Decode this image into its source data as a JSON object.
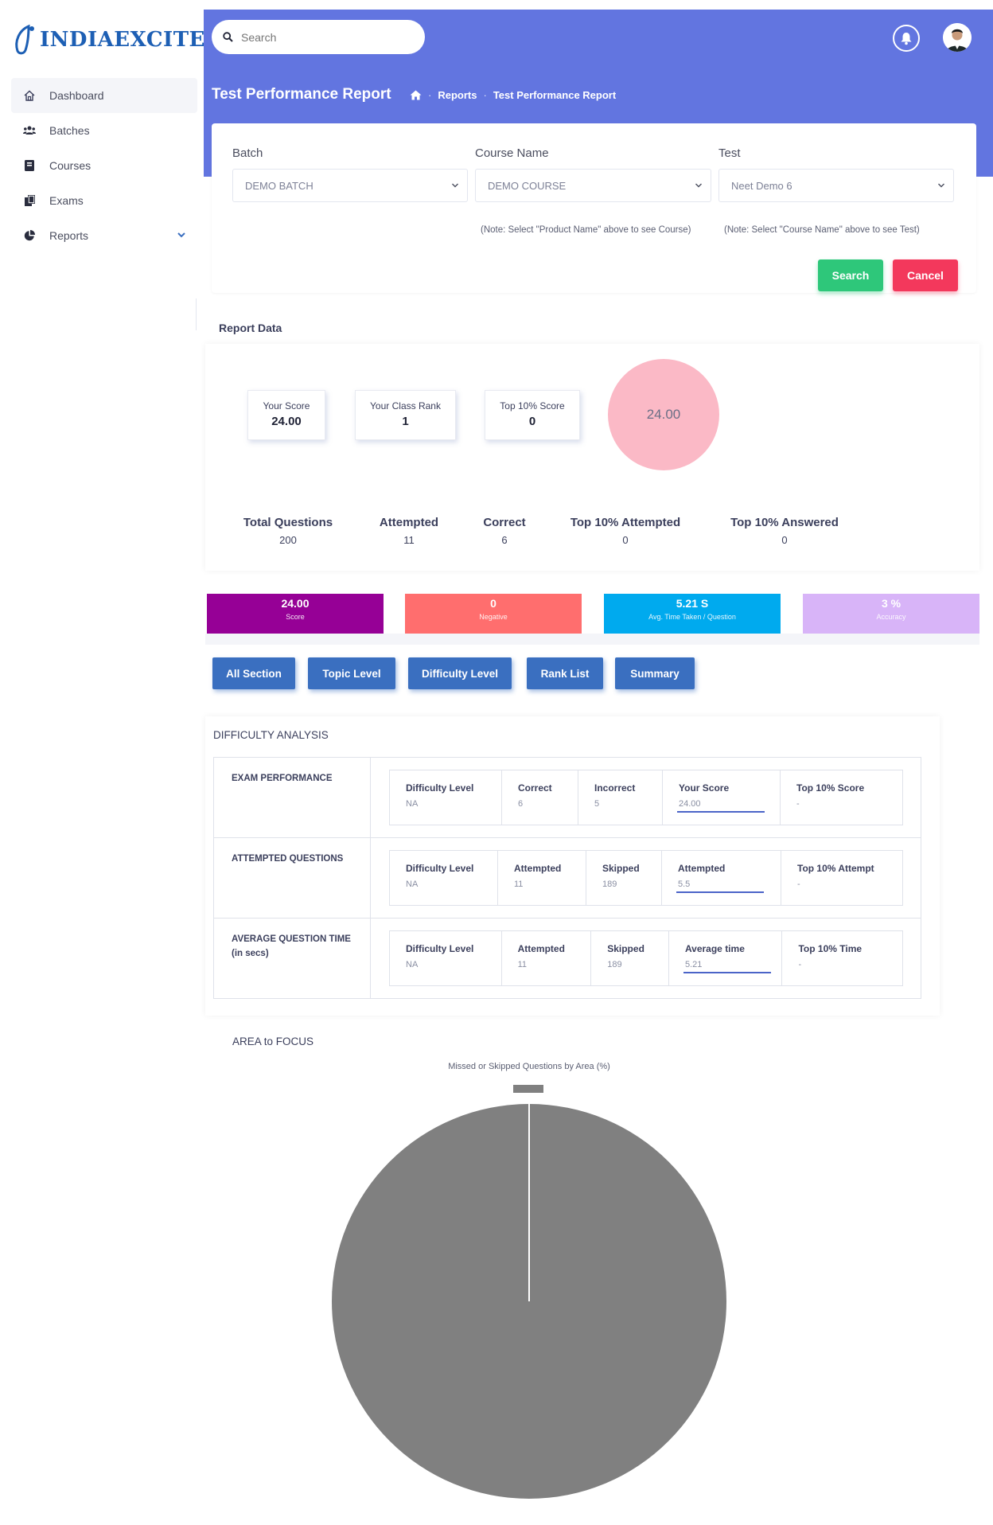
{
  "app": {
    "logo_text": "INDIAEXCITE"
  },
  "sidebar": {
    "items": [
      {
        "label": "Dashboard",
        "icon": "home-icon",
        "active": true
      },
      {
        "label": "Batches",
        "icon": "users-icon"
      },
      {
        "label": "Courses",
        "icon": "book-icon"
      },
      {
        "label": "Exams",
        "icon": "copy-icon"
      },
      {
        "label": "Reports",
        "icon": "pie-chart-icon",
        "has_submenu": true
      }
    ]
  },
  "header": {
    "search_placeholder": "Search",
    "page_title": "Test Performance Report",
    "breadcrumb": [
      "Reports",
      "Test Performance Report"
    ],
    "accent": "#6275e0"
  },
  "filters": {
    "batch": {
      "label": "Batch",
      "value": "DEMO BATCH"
    },
    "course": {
      "label": "Course Name",
      "value": "DEMO COURSE",
      "note": "(Note: Select \"Product Name\" above to see Course)"
    },
    "test": {
      "label": "Test",
      "value": "Neet Demo 6",
      "note": "(Note: Select \"Course Name\" above to see Test)"
    },
    "search_label": "Search",
    "cancel_label": "Cancel"
  },
  "report": {
    "title": "Report Data",
    "cards": [
      {
        "label": "Your Score",
        "value": "24.00"
      },
      {
        "label": "Your Class Rank",
        "value": "1"
      },
      {
        "label": "Top 10% Score",
        "value": "0"
      }
    ],
    "circle_value": "24.00",
    "stats": [
      {
        "label": "Total Questions",
        "value": "200"
      },
      {
        "label": "Attempted",
        "value": "11"
      },
      {
        "label": "Correct",
        "value": "6"
      },
      {
        "label": "Top 10% Attempted",
        "value": "0"
      },
      {
        "label": "Top 10% Answered",
        "value": "0"
      }
    ],
    "tiles": [
      {
        "value": "24.00",
        "label": "Score",
        "color": "#960096"
      },
      {
        "value": "0",
        "label": "Negative",
        "color": "#ff6e6e"
      },
      {
        "value": "5.21 S",
        "label": "Avg. Time Taken / Question",
        "color": "#00aaee"
      },
      {
        "value": "3 %",
        "label": "Accuracy",
        "color": "#d8b4f8"
      }
    ]
  },
  "tabs": [
    "All Section",
    "Topic Level",
    "Difficulty Level",
    "Rank List",
    "Summary"
  ],
  "difficulty": {
    "title": "DIFFICULTY ANALYSIS",
    "rows": [
      {
        "label": "EXAM PERFORMANCE",
        "cells": [
          {
            "head": "Difficulty Level",
            "value": "NA"
          },
          {
            "head": "Correct",
            "value": "6"
          },
          {
            "head": "Incorrect",
            "value": "5"
          },
          {
            "head": "Your Score",
            "value": "24.00",
            "underline": true
          },
          {
            "head": "Top 10% Score",
            "value": "-"
          }
        ]
      },
      {
        "label": "ATTEMPTED QUESTIONS",
        "cells": [
          {
            "head": "Difficulty Level",
            "value": "NA"
          },
          {
            "head": "Attempted",
            "value": "11"
          },
          {
            "head": "Skipped",
            "value": "189"
          },
          {
            "head": "Attempted",
            "value": "5.5",
            "underline": true
          },
          {
            "head": "Top 10% Attempt",
            "value": "-"
          }
        ]
      },
      {
        "label": "AVERAGE QUESTION TIME",
        "label2": "(in secs)",
        "cells": [
          {
            "head": "Difficulty Level",
            "value": "NA"
          },
          {
            "head": "Attempted",
            "value": "11"
          },
          {
            "head": "Skipped",
            "value": "189"
          },
          {
            "head": "Average time",
            "value": "5.21",
            "underline": true
          },
          {
            "head": "Top 10% Time",
            "value": "-"
          }
        ]
      }
    ]
  },
  "focus": {
    "title": "AREA to FOCUS",
    "chart_title": "Missed or Skipped Questions by Area (%)"
  },
  "chart_data": {
    "type": "pie",
    "title": "Missed or Skipped Questions by Area (%)",
    "categories": [
      ""
    ],
    "values": [
      100
    ],
    "colors": [
      "#808080"
    ],
    "legend": "top"
  }
}
